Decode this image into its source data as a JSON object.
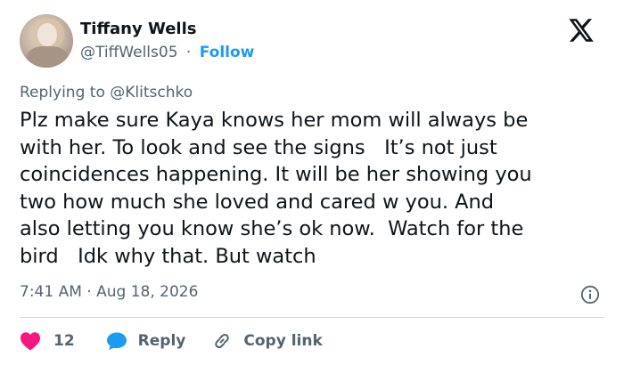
{
  "author": {
    "name": "Tiffany Wells",
    "handle": "@TiffWells05",
    "separator": "·",
    "follow_label": "Follow"
  },
  "reply_context": {
    "prefix": "Replying to ",
    "mention": "@Klitschko"
  },
  "tweet": {
    "text": "Plz make sure Kaya knows her mom will always be\nwith her. To look and see the signs   It’s not just\ncoincidences happening. It will be her showing you\ntwo how much she loved and cared w you. And\nalso letting you know she’s ok now.  Watch for the\nbird   Idk why that. But watch"
  },
  "meta": {
    "time": "7:41 AM",
    "separator": "·",
    "date": "Aug 18, 2026"
  },
  "actions": {
    "like_count": "12",
    "reply_label": "Reply",
    "copy_link_label": "Copy link"
  },
  "icons": {
    "logo": "x-logo-icon",
    "info": "info-icon",
    "like": "heart-icon",
    "reply": "speech-bubble-icon",
    "copy": "link-icon"
  },
  "colors": {
    "accent": "#1d9bf0",
    "like": "#f91880",
    "text": "#0f1419",
    "muted": "#536471",
    "divider": "#cfd9de"
  }
}
